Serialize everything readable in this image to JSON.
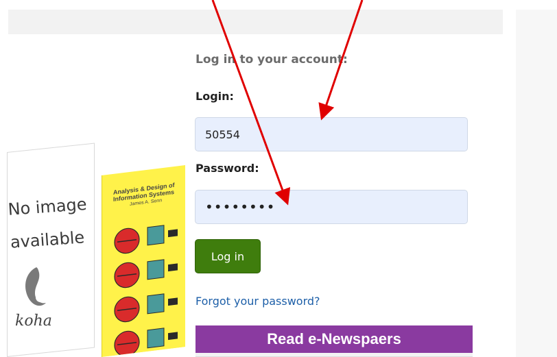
{
  "login": {
    "heading": "Log in to your account:",
    "login_label": "Login:",
    "login_value": "50554",
    "password_label": "Password:",
    "password_value": "••••••••",
    "submit_label": "Log in",
    "forgot_link": "Forgot your password?"
  },
  "carousel": {
    "no_image_line1": "No image",
    "no_image_line2": "available",
    "logo_word": "koha",
    "book_title": "Analysis & Design of Information Systems",
    "book_author": "James A. Senn"
  },
  "banner": {
    "label": "Read e-Newspaers"
  },
  "colors": {
    "annotation_arrow": "#e00000",
    "login_button": "#3f7d0d",
    "link": "#1d5fa8",
    "banner": "#8a3aa0",
    "input_fill": "#e8effd"
  }
}
